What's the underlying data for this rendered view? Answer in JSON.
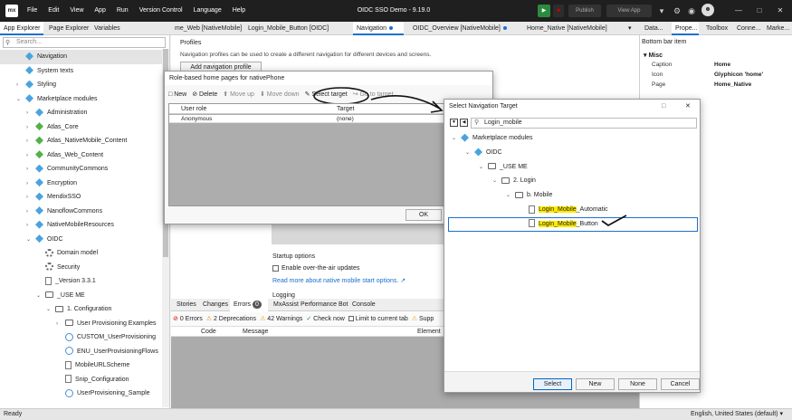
{
  "titlebar": {
    "logo": "mx",
    "menu": [
      "File",
      "Edit",
      "View",
      "App",
      "Run",
      "Version Control",
      "Language",
      "Help"
    ],
    "app_title": "OIDC SSO Demo  -  9.19.0",
    "publish": "Publish",
    "view_app": "View App"
  },
  "left_tabs": [
    "App Explorer",
    "Page Explorer",
    "Variables"
  ],
  "doc_tabs": [
    "me_Web [NativeMobile]",
    "Login_Mobile_Button [OIDC]",
    "Navigation",
    "OIDC_Overview [NativeMobile]",
    "Home_Native [NativeMobile]"
  ],
  "right_tabs": [
    "Data...",
    "Prope...",
    "Toolbox",
    "Conne...",
    "Marke..."
  ],
  "search": {
    "placeholder": "Search..."
  },
  "tree": [
    {
      "label": "Navigation",
      "icon": "navigation-icon",
      "indent": 0,
      "twisty": ""
    },
    {
      "label": "System texts",
      "icon": "system-texts-icon",
      "indent": 0,
      "twisty": ""
    },
    {
      "label": "Styling",
      "icon": "styling-icon",
      "indent": 0,
      "twisty": ">"
    },
    {
      "label": "Marketplace modules",
      "icon": "module-icon",
      "indent": 0,
      "twisty": "v"
    },
    {
      "label": "Administration",
      "icon": "module-icon",
      "indent": 1,
      "twisty": ">"
    },
    {
      "label": "Atlas_Core",
      "icon": "module-green-icon",
      "indent": 1,
      "twisty": ">"
    },
    {
      "label": "Atlas_NativeMobile_Content",
      "icon": "module-green-icon",
      "indent": 1,
      "twisty": ">"
    },
    {
      "label": "Atlas_Web_Content",
      "icon": "module-green-icon",
      "indent": 1,
      "twisty": ">"
    },
    {
      "label": "CommunityCommons",
      "icon": "module-icon",
      "indent": 1,
      "twisty": ">"
    },
    {
      "label": "Encryption",
      "icon": "module-icon",
      "indent": 1,
      "twisty": ">"
    },
    {
      "label": "MendixSSO",
      "icon": "module-icon",
      "indent": 1,
      "twisty": ">"
    },
    {
      "label": "NanoflowCommons",
      "icon": "module-icon",
      "indent": 1,
      "twisty": ">"
    },
    {
      "label": "NativeMobileResources",
      "icon": "module-icon",
      "indent": 1,
      "twisty": ">"
    },
    {
      "label": "OIDC",
      "icon": "module-icon",
      "indent": 1,
      "twisty": "v"
    },
    {
      "label": "Domain model",
      "icon": "domain-model-icon",
      "indent": 2,
      "twisty": ""
    },
    {
      "label": "Security",
      "icon": "security-icon",
      "indent": 2,
      "twisty": ""
    },
    {
      "label": "_Version 3.3.1",
      "icon": "document-icon",
      "indent": 2,
      "twisty": ""
    },
    {
      "label": "_USE ME",
      "icon": "folder-icon",
      "indent": 2,
      "twisty": "v"
    },
    {
      "label": "1. Configuration",
      "icon": "folder-icon",
      "indent": 3,
      "twisty": "v"
    },
    {
      "label": "User Provisioning Examples",
      "icon": "folder-icon",
      "indent": 4,
      "twisty": ">"
    },
    {
      "label": "CUSTOM_UserProvisioning",
      "icon": "microflow-icon",
      "indent": 4,
      "twisty": ""
    },
    {
      "label": "ENU_UserProvisioningFlows",
      "icon": "enumeration-icon",
      "indent": 4,
      "twisty": ""
    },
    {
      "label": "MobileURLScheme",
      "icon": "constant-icon",
      "indent": 4,
      "twisty": ""
    },
    {
      "label": "Snip_Configuration",
      "icon": "snippet-icon",
      "indent": 4,
      "twisty": ""
    },
    {
      "label": "UserProvisioning_Sample",
      "icon": "microflow-icon",
      "indent": 4,
      "twisty": ""
    }
  ],
  "editor": {
    "profiles_label": "Profiles",
    "profiles_desc": "Navigation profiles can be used to create a different navigation for different devices and screens.",
    "add_profile": "Add navigation profile",
    "startup_options": "Startup options",
    "ota_label": "Enable over-the-air updates",
    "ota_link": "Read more about native mobile start options.",
    "logging": "Logging"
  },
  "bottom": {
    "tabs": [
      "Stories",
      "Changes",
      "Errors",
      "MxAssist Performance Bot",
      "Console"
    ],
    "errors_count": "0",
    "filters": [
      "0 Errors",
      "2 Deprecations",
      "42 Warnings",
      "Check now",
      "Limit to current tab",
      "Supp"
    ],
    "columns": [
      "Code",
      "Message",
      "Element"
    ]
  },
  "properties": {
    "header": "Bottom bar item",
    "section": "Misc",
    "rows": [
      {
        "k": "Caption",
        "v": "Home"
      },
      {
        "k": "Icon",
        "v": "Glyphicon 'home'"
      },
      {
        "k": "Page",
        "v": "Home_Native"
      }
    ]
  },
  "role_dialog": {
    "title": "Role-based home pages for nativePhone",
    "toolbar": [
      "New",
      "Delete",
      "Move up",
      "Move down",
      "Select target",
      "Go to target"
    ],
    "columns": [
      "User role",
      "Target"
    ],
    "rows": [
      {
        "role": "Anonymous",
        "target": "(none)"
      }
    ],
    "ok": "OK"
  },
  "nav_dialog": {
    "title": "Select Navigation Target",
    "search_value": "Login_mobile",
    "tree": [
      {
        "label": "Marketplace modules",
        "icon": "module-icon",
        "indent": 0,
        "twisty": "v",
        "hl": "",
        "rest": ""
      },
      {
        "label": "OIDC",
        "icon": "module-icon",
        "indent": 1,
        "twisty": "v",
        "hl": "",
        "rest": ""
      },
      {
        "label": "_USE ME",
        "icon": "folder-icon",
        "indent": 2,
        "twisty": "v",
        "hl": "",
        "rest": ""
      },
      {
        "label": "2. Login",
        "icon": "folder-icon",
        "indent": 3,
        "twisty": "v",
        "hl": "",
        "rest": ""
      },
      {
        "label": "b. Mobile",
        "icon": "folder-icon",
        "indent": 4,
        "twisty": "v",
        "hl": "",
        "rest": ""
      },
      {
        "label": "",
        "icon": "page-icon",
        "indent": 5,
        "twisty": "",
        "hl": "Login_Mobile",
        "rest": "_Automatic"
      },
      {
        "label": "",
        "icon": "page-icon",
        "indent": 5,
        "twisty": "",
        "hl": "Login_Mobile",
        "rest": "_Button"
      }
    ],
    "buttons": [
      "Select",
      "New",
      "None",
      "Cancel"
    ]
  },
  "status": {
    "left": "Ready",
    "right": "English, United States (default)"
  }
}
